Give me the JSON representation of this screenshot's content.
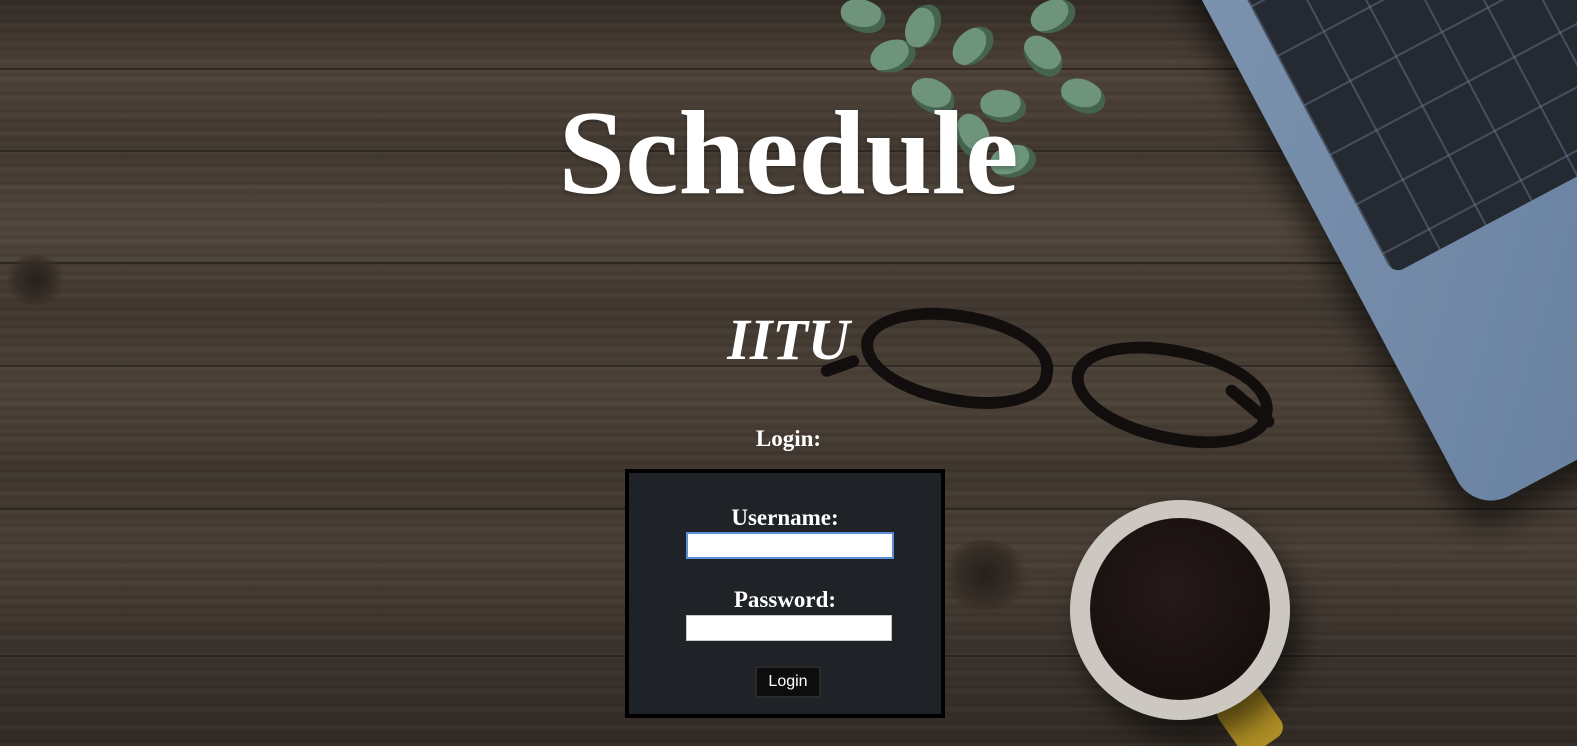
{
  "page": {
    "title": "Schedule",
    "subtitle": "IITU",
    "login_heading": "Login:"
  },
  "login_form": {
    "username_label": "Username:",
    "username_value": "",
    "password_label": "Password:",
    "password_value": "",
    "submit_label": "Login"
  },
  "colors": {
    "text": "#ffffff",
    "form_background": "#1f2226",
    "form_border": "#000000",
    "button_background": "#0d0d0d",
    "focus_outline": "#5b8ed6"
  },
  "background": {
    "scene": "wooden-desk-photo",
    "objects": [
      "succulent-plant",
      "laptop",
      "eyeglasses",
      "coffee-cup"
    ]
  }
}
